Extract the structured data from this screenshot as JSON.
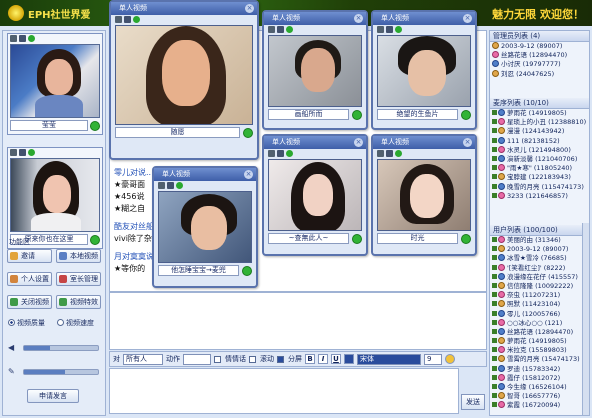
{
  "banner": {
    "logo_text": "EPH社世界爱",
    "slogan": "魅力无限 欢迎您！"
  },
  "left_panel": {
    "videos": [
      {
        "name": "莹莹"
      },
      {
        "name": "原来你也在这里"
      }
    ],
    "func_title": "功能区",
    "buttons": [
      {
        "label": "邀请"
      },
      {
        "label": "本地视频"
      },
      {
        "label": "个人设置"
      },
      {
        "label": "室长管理"
      },
      {
        "label": "关闭视频"
      },
      {
        "label": "视频特效"
      }
    ],
    "radio_quality": "视频质量",
    "radio_speed": "视频速度",
    "apply_button": "申请发言",
    "mic_level": 0.35,
    "speaker_level": 0.55
  },
  "windows": [
    {
      "title": "单人视频",
      "name": "随愿"
    },
    {
      "title": "单人视频",
      "name": "画船所而"
    },
    {
      "title": "单人视频",
      "name": "绝望的生鱼片"
    },
    {
      "title": "单人视频",
      "name": "~查無此人~"
    },
    {
      "title": "单人视频",
      "name": "时光"
    },
    {
      "title": "单人视频",
      "name": "他怎睡宝宝→麦兜"
    }
  ],
  "chat": {
    "lines": [
      "零儿对说...",
      "★豪哥面",
      "★456说",
      "★糊之自",
      "酷友对丝船",
      "vivi除了杂",
      "月对寞寞说",
      "★等你的"
    ]
  },
  "toolbar": {
    "to_label": "对",
    "to_value": "所有人",
    "action_label": "动作",
    "action_value": "",
    "emotion_label": "情情话",
    "scroll_label": "滚动",
    "split_label": "分屏",
    "bold": "B",
    "italic": "I",
    "underline": "U",
    "font_value": "宋体",
    "size_value": "9",
    "send": "发送"
  },
  "right_panel": {
    "admin_header": "管理员列表 (4)",
    "admin": [
      "2003-9-12 (89007)",
      "丝路花语 (12894470)",
      "小讨厌 (19797777)",
      "刘忍 (24047625)"
    ],
    "guest_header": "麦序列表 (10/10)",
    "guests": [
      "萝雨花 (14919805)",
      "星琐上的小丑 (12388810)",
      "漫漫 (124143942)",
      "111 (82138152)",
      "水灵儿 (121494800)",
      "演新淡馨 (121040706)",
      "\"雨★寒\" (11805240)",
      "宝脖建 (122183943)",
      "晚雪的月亮 (115474173)",
      "3233 (121646857)"
    ],
    "user_header": "用户列表 (100/100)",
    "users": [
      "美丽的由 (31346)",
      "2003-9-12 (89007)",
      "冰雪★雪冷 (76685)",
      "'[笑看红尘]' (8222)",
      "浪漫缘在花仔 (415557)",
      "信信隆隆 (10092222)",
      "奈虫 (11207231)",
      "照默 (11423104)",
      "零儿 (12005766)",
      "○○冰心○○ (121)",
      "丝路花语 (12894470)",
      "萝雨花 (14919805)",
      "米拉克 (15589803)",
      "雪霄的月亮 (15474173)",
      "罗迪 (15783342)",
      "霞仔 (15812072)",
      "今生缘 (16526104)",
      "智哥 (16657776)",
      "紫霞 (16720094)"
    ]
  }
}
